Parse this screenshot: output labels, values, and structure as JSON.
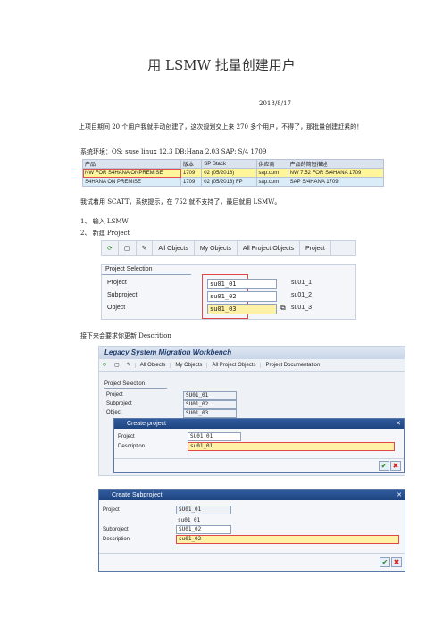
{
  "title": "用 LSMW 批量创建用户",
  "date": "2018/8/17",
  "intro": "上项目期间 20 个用户我就手动创建了，这次规划交上来 270 多个用户，不得了，那批量创建赶紧的！",
  "env": "系统环境：OS: suse linux 12.3    DB:Hana 2.03    SAP: S/4 1709",
  "product_table": {
    "headers": [
      "产品",
      "版本",
      "SP Stack",
      "供应商",
      "产品的简短描述"
    ],
    "rows": [
      [
        "NW FOR S4HANA ONPREMISE",
        "1709",
        "02 (05/2018)",
        "sap.com",
        "NW 7.52 FOR S/4HANA 1709"
      ],
      [
        "S4HANA ON PREMISE",
        "1709",
        "02 (05/2018) FP",
        "sap.com",
        "SAP S/4HANA 1709"
      ]
    ]
  },
  "scatt_note": "我试着用 SCATT，系统提示，在 752 就不支持了，最后就用 LSMW。",
  "steps": [
    {
      "num": "1、",
      "text": "输入 LSMW"
    },
    {
      "num": "2、",
      "text": "新建 Project"
    }
  ],
  "screen1": {
    "toolbar": [
      "All Objects",
      "My Objects",
      "All Project Objects",
      "Project"
    ],
    "section": "Project Selection",
    "rows": [
      {
        "label": "Project",
        "value": "su01_01",
        "desc": "su01_1"
      },
      {
        "label": "Subproject",
        "value": "su01_02",
        "desc": "su01_2"
      },
      {
        "label": "Object",
        "value": "su01_03",
        "desc": "su01_3"
      }
    ]
  },
  "describe_note": "接下来会要求你更新 Descrition",
  "screen2": {
    "header": "Legacy System Migration Workbench",
    "toolbar": [
      "All Objects",
      "My Objects",
      "All Project Objects",
      "Project Documentation"
    ],
    "section": "Project Selection",
    "rows": [
      {
        "label": "Project",
        "value": "SU01_01"
      },
      {
        "label": "Subproject",
        "value": "SU01_02"
      },
      {
        "label": "Object",
        "value": "SU01_03"
      }
    ],
    "dialog": {
      "title": "Create project",
      "project_label": "Project",
      "project_value": "SU01_01",
      "desc_label": "Description",
      "desc_value": "su01_01"
    }
  },
  "screen3": {
    "dialog": {
      "title": "Create Subproject",
      "project_label": "Project",
      "project_value": "SU01_01",
      "project_desc": "su01_01",
      "sub_label": "Subproject",
      "sub_value": "SU01_02",
      "desc_label": "Description",
      "desc_value": "su01_02"
    }
  },
  "colors": {
    "dialog_title": "#2f5a9c",
    "highlight": "#fff1a6",
    "red": "#e04848"
  }
}
